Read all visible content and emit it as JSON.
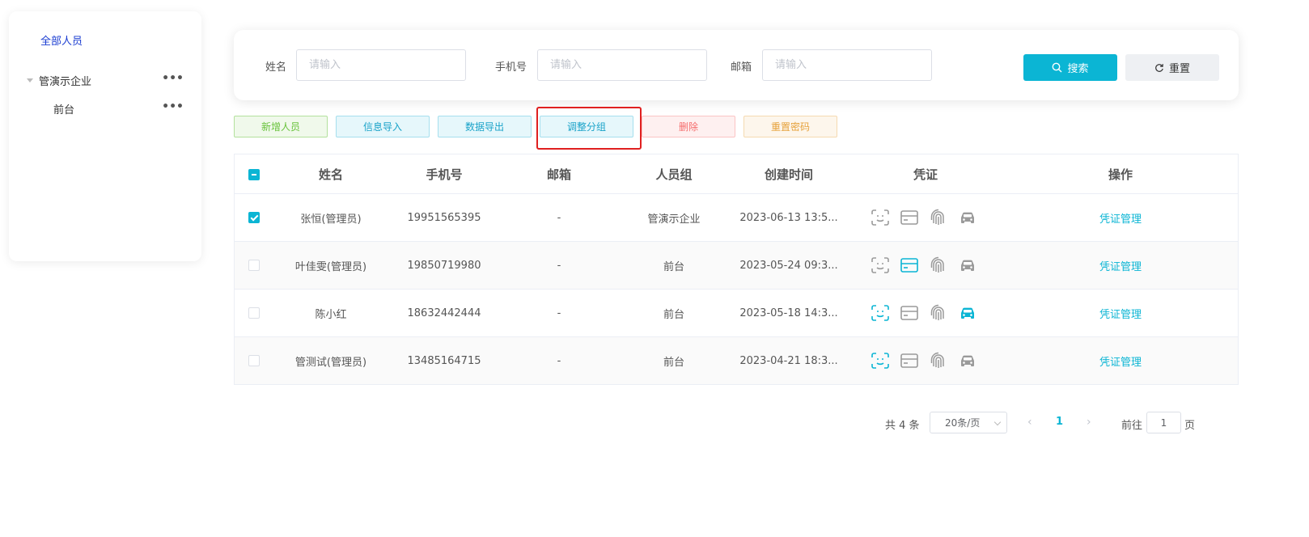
{
  "sidebar": {
    "all_label": "全部人员",
    "nodes": [
      {
        "label": "管演示企业",
        "more": "•••"
      },
      {
        "label": "前台",
        "more": "•••"
      }
    ]
  },
  "search": {
    "name_label": "姓名",
    "name_placeholder": "请输入",
    "phone_label": "手机号",
    "phone_placeholder": "请输入",
    "email_label": "邮箱",
    "email_placeholder": "请输入",
    "search_button": "搜索",
    "reset_button": "重置"
  },
  "actions": {
    "add": "新增人员",
    "import": "信息导入",
    "export": "数据导出",
    "group": "调整分组",
    "delete": "删除",
    "reset_password": "重置密码"
  },
  "table": {
    "headers": {
      "name": "姓名",
      "phone": "手机号",
      "email": "邮箱",
      "group": "人员组",
      "created": "创建时间",
      "credential": "凭证",
      "operation": "操作"
    },
    "rows": [
      {
        "checked": true,
        "name": "张恒(管理员)",
        "phone": "19951565395",
        "email": "-",
        "group": "管演示企业",
        "created": "2023-06-13 13:5...",
        "op": "凭证管理",
        "cred_active": {
          "face": false,
          "card": false,
          "finger": false,
          "car": false
        }
      },
      {
        "checked": false,
        "name": "叶佳雯(管理员)",
        "phone": "19850719980",
        "email": "-",
        "group": "前台",
        "created": "2023-05-24 09:3...",
        "op": "凭证管理",
        "cred_active": {
          "face": false,
          "card": true,
          "finger": false,
          "car": false
        }
      },
      {
        "checked": false,
        "name": "陈小红",
        "phone": "18632442444",
        "email": "-",
        "group": "前台",
        "created": "2023-05-18 14:3...",
        "op": "凭证管理",
        "cred_active": {
          "face": true,
          "card": false,
          "finger": false,
          "car": true
        }
      },
      {
        "checked": false,
        "name": "管测试(管理员)",
        "phone": "13485164715",
        "email": "-",
        "group": "前台",
        "created": "2023-04-21 18:3...",
        "op": "凭证管理",
        "cred_active": {
          "face": true,
          "card": false,
          "finger": false,
          "car": false
        }
      }
    ]
  },
  "pagination": {
    "total": "共 4 条",
    "page_size": "20条/页",
    "current_page": "1",
    "goto_label": "前往",
    "goto_value": "1",
    "page_suffix": "页"
  },
  "colors": {
    "accent": "#0bb5d4",
    "inactive_icon": "#9a9a9a",
    "highlight": "#e02020"
  }
}
